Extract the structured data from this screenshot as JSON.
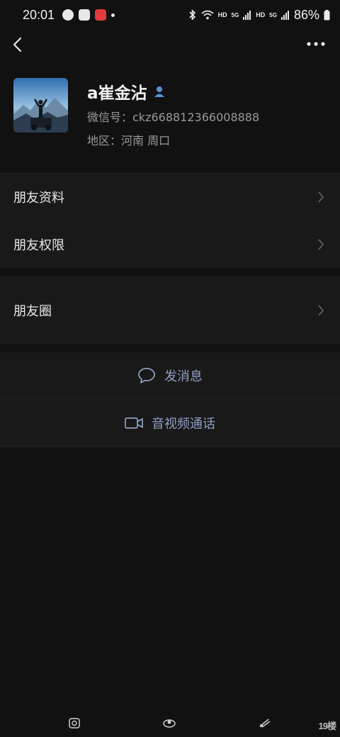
{
  "status_bar": {
    "time": "20:01",
    "battery": "86%",
    "hd1": "HD",
    "net1": "5G",
    "hd2": "HD",
    "net2": "5G"
  },
  "profile": {
    "name": "a崔金沾",
    "wechat_id": "微信号：ckz668812366008888",
    "region": "地区：河南  周口"
  },
  "menu": {
    "friend_profile": "朋友资料",
    "friend_permission": "朋友权限",
    "moments": "朋友圈"
  },
  "actions": {
    "message": "发消息",
    "video_call": "音视频通话"
  },
  "watermark": "19楼",
  "colors": {
    "background": "#111111",
    "row": "#191919",
    "action_text": "#8fa0c2",
    "contact_icon": "#5b8fd6"
  }
}
